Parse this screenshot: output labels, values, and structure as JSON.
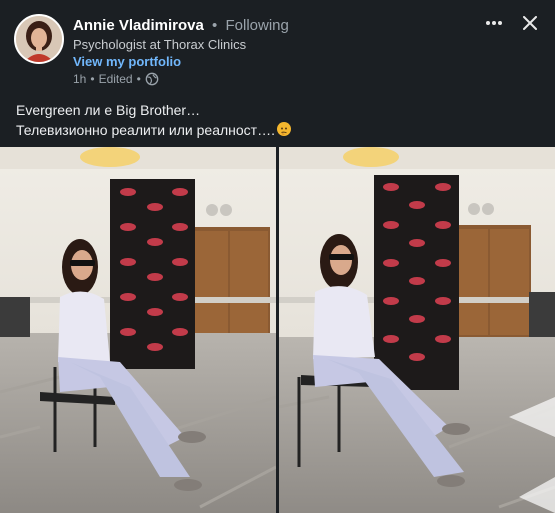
{
  "author": {
    "name": "Annie Vladimirova",
    "separator": "•",
    "status": "Following",
    "headline": "Psychologist at Thorax Clinics",
    "portfolio_link": "View my portfolio",
    "avatar_icon": "profile-photo"
  },
  "meta": {
    "time": "1h",
    "separator": "•",
    "edited": "Edited",
    "separator2": "•",
    "visibility_icon": "globe-icon"
  },
  "actions": {
    "more_icon": "more-horizontal-icon",
    "close_icon": "close-icon"
  },
  "post": {
    "line1": "Evergreen ли е Big Brother…",
    "line2": "Телевизионно реалити или реалност….",
    "emoji": "thinking-face"
  },
  "photos": [
    {
      "alt_icon": "photo-woman-seated-big-brother-backdrop-1"
    },
    {
      "alt_icon": "photo-woman-seated-big-brother-backdrop-2"
    }
  ],
  "colors": {
    "background": "#1b1f23",
    "link": "#71b7fb",
    "secondary_text": "#9aa3ab"
  }
}
